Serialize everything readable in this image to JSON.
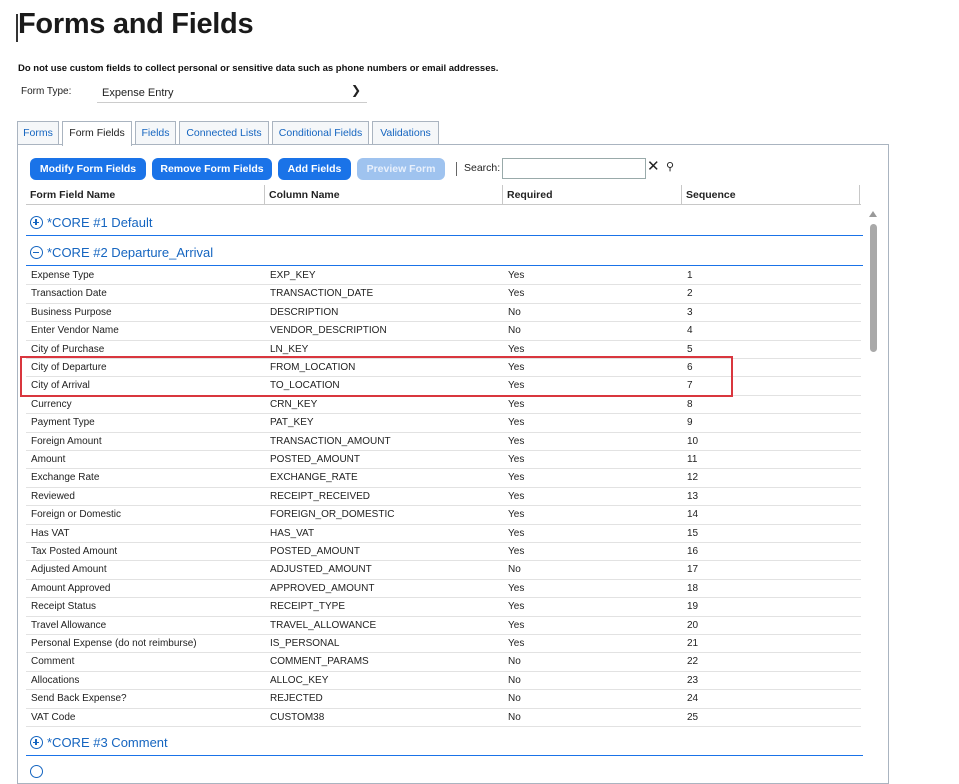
{
  "page": {
    "title": "Forms and Fields",
    "notice": "Do not use custom fields to collect personal or sensitive data such as phone numbers or email addresses."
  },
  "form_type": {
    "label": "Form Type:",
    "value": "Expense Entry"
  },
  "tabs": [
    {
      "label": "Forms"
    },
    {
      "label": "Form Fields"
    },
    {
      "label": "Fields"
    },
    {
      "label": "Connected Lists"
    },
    {
      "label": "Conditional Fields"
    },
    {
      "label": "Validations"
    }
  ],
  "active_tab": "Form Fields",
  "toolbar": {
    "modify": "Modify Form Fields",
    "remove": "Remove Form Fields",
    "add": "Add Fields",
    "preview": "Preview Form",
    "search_label": "Search:",
    "search_value": ""
  },
  "columns": [
    "Form Field Name",
    "Column Name",
    "Required",
    "Sequence"
  ],
  "groups": [
    {
      "title": "*CORE #1 Default",
      "expanded": false
    },
    {
      "title": "*CORE #2 Departure_Arrival",
      "expanded": true
    },
    {
      "title": "*CORE #3 Comment",
      "expanded": false
    }
  ],
  "rows": [
    {
      "name": "Expense Type",
      "column": "EXP_KEY",
      "required": "Yes",
      "seq": "1"
    },
    {
      "name": "Transaction Date",
      "column": "TRANSACTION_DATE",
      "required": "Yes",
      "seq": "2"
    },
    {
      "name": "Business Purpose",
      "column": "DESCRIPTION",
      "required": "No",
      "seq": "3"
    },
    {
      "name": "Enter Vendor Name",
      "column": "VENDOR_DESCRIPTION",
      "required": "No",
      "seq": "4"
    },
    {
      "name": "City of Purchase",
      "column": "LN_KEY",
      "required": "Yes",
      "seq": "5"
    },
    {
      "name": "City of Departure",
      "column": "FROM_LOCATION",
      "required": "Yes",
      "seq": "6"
    },
    {
      "name": "City of Arrival",
      "column": "TO_LOCATION",
      "required": "Yes",
      "seq": "7"
    },
    {
      "name": "Currency",
      "column": "CRN_KEY",
      "required": "Yes",
      "seq": "8"
    },
    {
      "name": "Payment Type",
      "column": "PAT_KEY",
      "required": "Yes",
      "seq": "9"
    },
    {
      "name": "Foreign Amount",
      "column": "TRANSACTION_AMOUNT",
      "required": "Yes",
      "seq": "10"
    },
    {
      "name": "Amount",
      "column": "POSTED_AMOUNT",
      "required": "Yes",
      "seq": "11"
    },
    {
      "name": "Exchange Rate",
      "column": "EXCHANGE_RATE",
      "required": "Yes",
      "seq": "12"
    },
    {
      "name": "Reviewed",
      "column": "RECEIPT_RECEIVED",
      "required": "Yes",
      "seq": "13"
    },
    {
      "name": "Foreign or Domestic",
      "column": "FOREIGN_OR_DOMESTIC",
      "required": "Yes",
      "seq": "14"
    },
    {
      "name": "Has VAT",
      "column": "HAS_VAT",
      "required": "Yes",
      "seq": "15"
    },
    {
      "name": "Tax Posted Amount",
      "column": "POSTED_AMOUNT",
      "required": "Yes",
      "seq": "16"
    },
    {
      "name": "Adjusted Amount",
      "column": "ADJUSTED_AMOUNT",
      "required": "No",
      "seq": "17"
    },
    {
      "name": "Amount Approved",
      "column": "APPROVED_AMOUNT",
      "required": "Yes",
      "seq": "18"
    },
    {
      "name": "Receipt Status",
      "column": "RECEIPT_TYPE",
      "required": "Yes",
      "seq": "19"
    },
    {
      "name": "Travel Allowance",
      "column": "TRAVEL_ALLOWANCE",
      "required": "Yes",
      "seq": "20"
    },
    {
      "name": "Personal Expense (do not reimburse)",
      "column": "IS_PERSONAL",
      "required": "Yes",
      "seq": "21"
    },
    {
      "name": "Comment",
      "column": "COMMENT_PARAMS",
      "required": "No",
      "seq": "22"
    },
    {
      "name": "Allocations",
      "column": "ALLOC_KEY",
      "required": "No",
      "seq": "23"
    },
    {
      "name": "Send Back Expense?",
      "column": "REJECTED",
      "required": "No",
      "seq": "24"
    },
    {
      "name": "VAT Code",
      "column": "CUSTOM38",
      "required": "No",
      "seq": "25"
    }
  ],
  "colors": {
    "accent": "#1a73e8",
    "link": "#1565c0",
    "highlight": "#d9363e"
  }
}
